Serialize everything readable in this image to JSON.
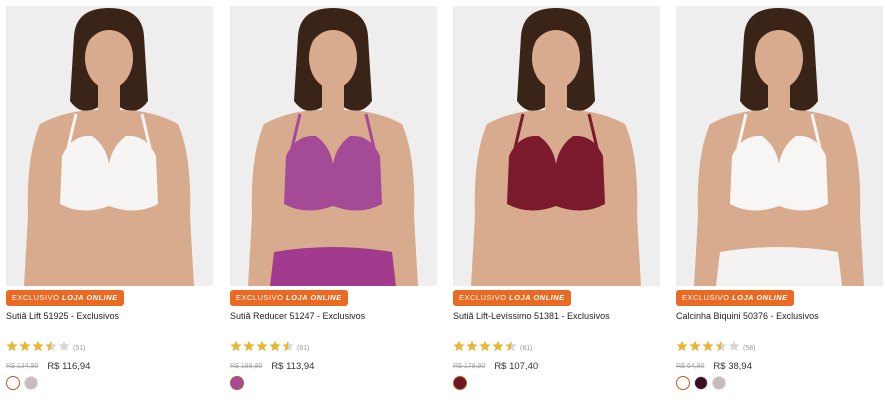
{
  "products": [
    {
      "badge_a": "EXCLUSIVO",
      "badge_b": "LOJA ONLINE",
      "name": "Sutiã Lift 51925 - Exclusivos",
      "rating": 3.5,
      "reviews": "(51)",
      "old_price": "R$ 134,90",
      "price": "R$ 116,94",
      "bra_color": "#f6f5f3",
      "bottom_color": "",
      "swatches": [
        {
          "color": "#ffffff",
          "selected": true
        },
        {
          "color": "#c8bcbc",
          "selected": false
        }
      ]
    },
    {
      "badge_a": "EXCLUSIVO",
      "badge_b": "LOJA ONLINE",
      "name": "Sutiã Reducer 51247 - Exclusivos",
      "rating": 4.5,
      "reviews": "(81)",
      "old_price": "R$ 189,90",
      "price": "R$ 113,94",
      "bra_color": "#a54a96",
      "bottom_color": "#a23b8e",
      "swatches": [
        {
          "color": "#a54a96",
          "selected": true
        }
      ]
    },
    {
      "badge_a": "EXCLUSIVO",
      "badge_b": "LOJA ONLINE",
      "name": "Sutiã Lift-Levíssimo 51381 - Exclusivos",
      "rating": 4.5,
      "reviews": "(81)",
      "old_price": "R$ 179,90",
      "price": "R$ 107,40",
      "bra_color": "#7a1a2c",
      "bottom_color": "",
      "swatches": [
        {
          "color": "#6d1624",
          "selected": true
        }
      ]
    },
    {
      "badge_a": "EXCLUSIVO",
      "badge_b": "LOJA ONLINE",
      "name": "Calcinha Biquini 50376 - Exclusivos",
      "rating": 3.5,
      "reviews": "(58)",
      "old_price": "R$ 64,90",
      "price": "R$ 38,94",
      "bra_color": "#f7f6f4",
      "bottom_color": "#f4f3f1",
      "swatches": [
        {
          "color": "#ffffff",
          "selected": true
        },
        {
          "color": "#3a1020",
          "selected": false
        },
        {
          "color": "#c8bcbc",
          "selected": false
        }
      ]
    }
  ],
  "colors": {
    "badge": "#ea6a24",
    "star_full": "#e8b534",
    "star_empty": "#d6d6d6",
    "photo_bg": "#eeeeee",
    "skin": "#d9ab8e",
    "hair": "#3a2418"
  },
  "icons": {
    "star": "star-icon",
    "half_star": "star-half-icon",
    "empty_star": "star-empty-icon"
  }
}
